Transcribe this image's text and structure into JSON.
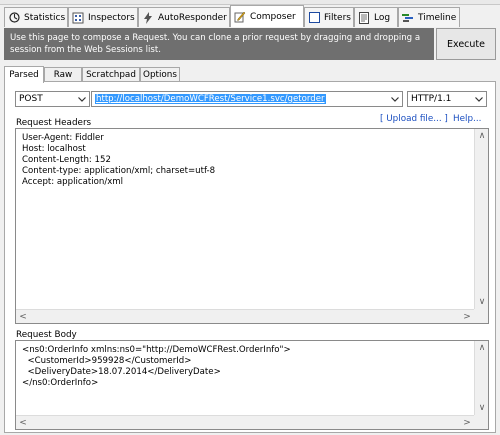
{
  "tabs": [
    {
      "label": "Statistics",
      "icon": "statistics-icon"
    },
    {
      "label": "Inspectors",
      "icon": "inspectors-icon"
    },
    {
      "label": "AutoResponder",
      "icon": "lightning-icon"
    },
    {
      "label": "Composer",
      "icon": "composer-icon"
    },
    {
      "label": "Filters",
      "icon": "checkbox-icon"
    },
    {
      "label": "Log",
      "icon": "log-icon"
    },
    {
      "label": "Timeline",
      "icon": "timeline-icon"
    }
  ],
  "banner": {
    "text": "Use this page to compose a Request. You can clone a prior request by dragging and dropping a session from the Web Sessions list.",
    "execute_label": "Execute"
  },
  "subtabs": [
    "Parsed",
    "Raw",
    "Scratchpad",
    "Options"
  ],
  "request": {
    "method": "POST",
    "url": "http://localhost/DemoWCFRest/Service1.svc/getorder",
    "version": "HTTP/1.1"
  },
  "headers": {
    "title": "Request Headers",
    "upload_link": "[ Upload file... ]",
    "help_link": "Help...",
    "lines": [
      "User-Agent: Fiddler",
      "Host: localhost",
      "Content-Length: 152",
      "Content-type: application/xml; charset=utf-8",
      "Accept: application/xml"
    ]
  },
  "body": {
    "title": "Request Body",
    "lines": [
      "<ns0:OrderInfo xmlns:ns0=\"http://DemoWCFRest.OrderInfo\">",
      "  <CustomerId>959928</CustomerId>",
      "  <DeliveryDate>18.07.2014</DeliveryDate>",
      "</ns0:OrderInfo>"
    ]
  },
  "colors": {
    "banner_bg": "#6f6f6f",
    "url_highlight": "#3399ff",
    "link": "#1a4ec0"
  }
}
